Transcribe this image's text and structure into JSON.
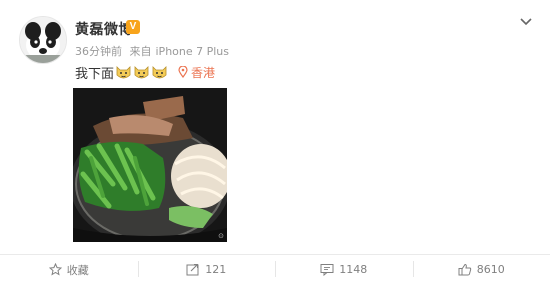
{
  "post": {
    "author": "黄磊微博",
    "verified_badge": "V",
    "time": "36分钟前",
    "source_prefix": "来自",
    "source": "iPhone 7 Plus",
    "text": "我下面",
    "emoji_count": 3,
    "emoji_icon": "doge-emoji-icon",
    "location": "香港"
  },
  "actions": {
    "favorite_label": "收藏",
    "repost_count": "121",
    "comment_count": "1148",
    "like_count": "8610"
  },
  "colors": {
    "location": "#eb7350",
    "badge": "#f8a41b",
    "muted": "#808080"
  }
}
